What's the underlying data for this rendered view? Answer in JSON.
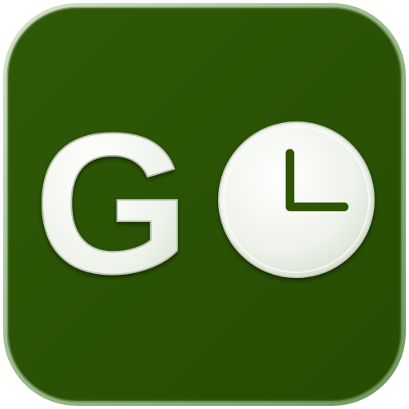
{
  "icon": {
    "logo_text": "G",
    "icon_name": "clock-icon",
    "colors": {
      "background": "#2d5505",
      "background_light_edge": "#8fae7f",
      "border": "#c9d8be",
      "glyph_fill": "#eef2ea",
      "glyph_shadow": "#bcc9b4",
      "glyph_highlight": "#ffffff",
      "clock_hands": "#2d5505"
    }
  }
}
